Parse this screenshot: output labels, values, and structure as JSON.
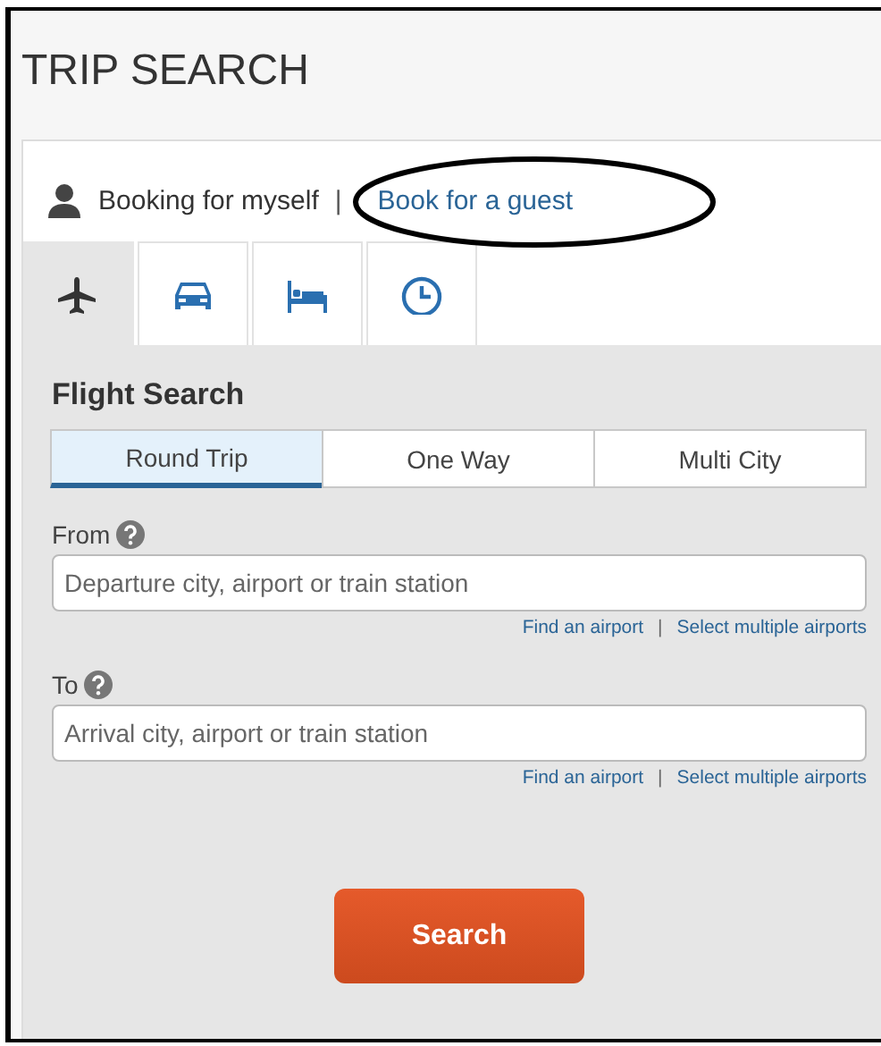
{
  "title": "TRIP SEARCH",
  "booking": {
    "current": "Booking for myself",
    "separator": "|",
    "guest_link": "Book for a guest"
  },
  "tabs": [
    {
      "kind": "flight",
      "selected": true
    },
    {
      "kind": "car",
      "selected": false
    },
    {
      "kind": "hotel",
      "selected": false
    },
    {
      "kind": "time",
      "selected": false
    }
  ],
  "heading": "Flight Search",
  "trip_types": [
    {
      "label": "Round Trip",
      "selected": true
    },
    {
      "label": "One Way",
      "selected": false
    },
    {
      "label": "Multi City",
      "selected": false
    }
  ],
  "fields": [
    {
      "label": "From",
      "placeholder": "Departure city, airport or train station",
      "find_link": "Find an airport",
      "separator": "|",
      "multiple_link": "Select multiple airports"
    },
    {
      "label": "To",
      "placeholder": "Arrival city, airport or train station",
      "find_link": "Find an airport",
      "separator": "|",
      "multiple_link": "Select multiple airports"
    }
  ],
  "search_button": "Search"
}
